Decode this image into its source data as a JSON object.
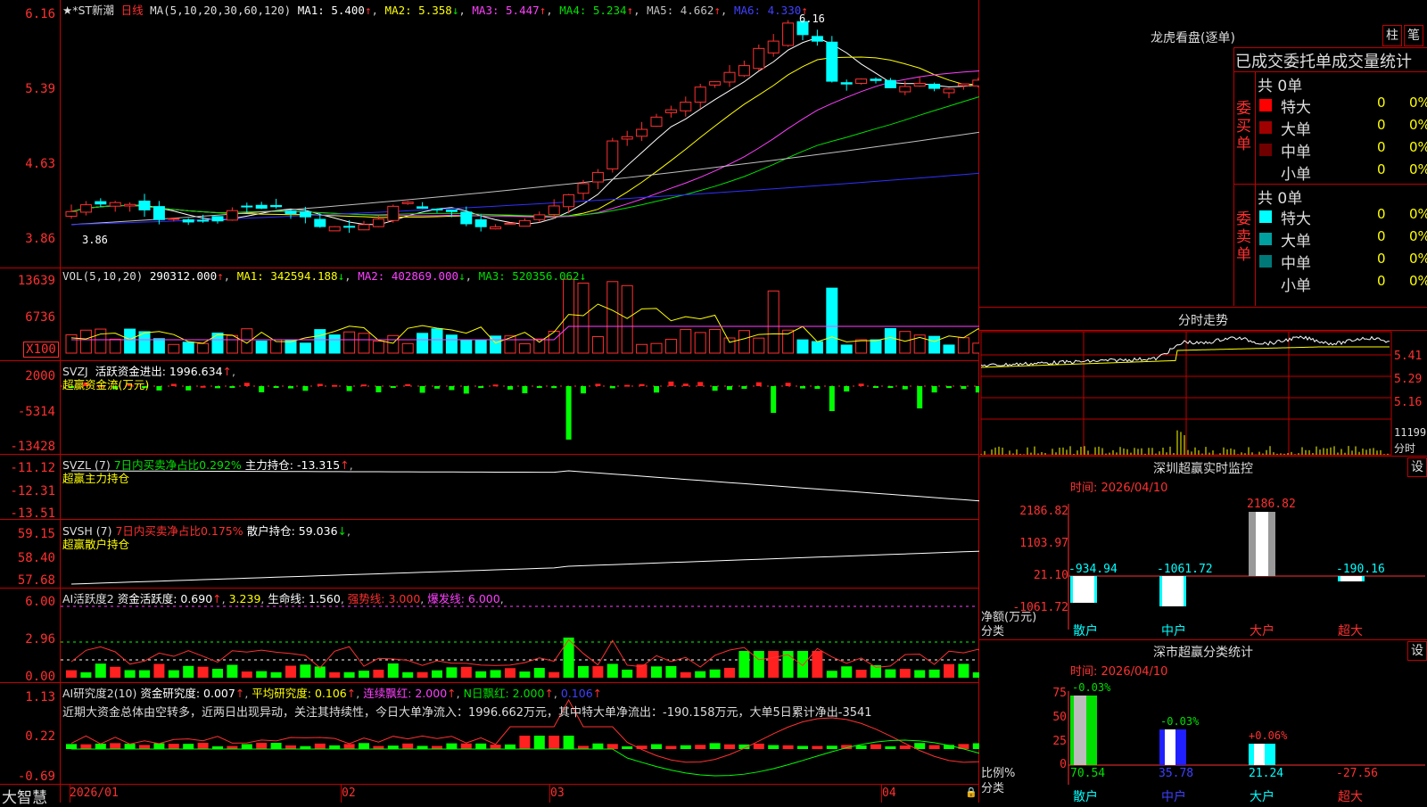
{
  "app_logo": "大智慧",
  "colors": {
    "red": "#ff3030",
    "cyan": "#00ffff",
    "green": "#00e000",
    "yellow": "#ffff00",
    "magenta": "#ff40ff",
    "white": "#ffffff",
    "blue": "#4040ff",
    "grid": "#c00000"
  },
  "chart": {
    "stock_name": "★*ST新潮",
    "period": "日线",
    "ma_label": "MA(5,10,20,30,60,120)",
    "ma1": "MA1: 5.400",
    "ma2": "MA2: 5.358",
    "ma3": "MA3: 5.447",
    "ma4": "MA4: 5.234",
    "ma5": "MA5: 4.662",
    "ma6": "MA6: 4.330",
    "high_label": "6.16",
    "low_label": "3.86",
    "price_axis": [
      "6.16",
      "5.39",
      "4.63",
      "3.86"
    ],
    "vol_label": "VOL(5,10,20)",
    "vol_value": "290312.000",
    "vol_ma1": "MA1: 342594.188",
    "vol_ma2": "MA2: 402869.000",
    "vol_ma3": "MA3: 520356.062",
    "vol_axis": [
      "13639",
      "6736",
      "X100"
    ],
    "svzj_label": "SVZJ",
    "svzj_text": "活跃资金进出: 1996.634",
    "svzj_sub": "超赢资金流(万元)",
    "svzj_axis": [
      "2000",
      "-5314",
      "-13428"
    ],
    "svzl_label": "SVZL (7)",
    "svzl_text1": "7日内买卖净占比0.292%",
    "svzl_text2": "主力持仓: -13.315",
    "svzl_sub": "超赢主力持仓",
    "svzl_axis": [
      "-11.12",
      "-12.31",
      "-13.51"
    ],
    "svsh_label": "SVSH (7)",
    "svsh_text1": "7日内买卖净占比0.175%",
    "svsh_text2": "散户持仓: 59.036",
    "svsh_sub": "超赢散户持仓",
    "svsh_axis": [
      "59.15",
      "58.40",
      "57.68"
    ],
    "ai2_label": "AI活跃度2",
    "ai2_text1": "资金活跃度: 0.690",
    "ai2_text2": "3.239",
    "ai2_text3": "生命线: 1.560",
    "ai2_text4": "强势线: 3.000",
    "ai2_text5": "爆发线: 6.000",
    "ai2_axis": [
      "6.00",
      "2.96",
      "0.00"
    ],
    "ai_res_label": "AI研究度2(10)",
    "ai_res_text1": "资金研究度: 0.007",
    "ai_res_text2": "平均研究度: 0.106",
    "ai_res_text3": "连续飘红: 2.000",
    "ai_res_text4": "N日飘红: 2.000",
    "ai_res_text5": "0.106",
    "ai_res_comment": "近期大资金总体由空转多，近两日出现异动，关注其持续性，今日大单净流入：1996.662万元，其中特大单净流出：-190.158万元，大单5日累计净出-3541",
    "ai_res_axis": [
      "1.13",
      "0.22",
      "-0.69"
    ],
    "dates": [
      "2026/01",
      "02",
      "03",
      "04"
    ]
  },
  "right": {
    "lhb_title": "龙虎看盘(逐单)",
    "btn_zhu": "柱",
    "btn_bi": "笔",
    "stats_title": "已成交委托单成交量统计",
    "buy_count": "共 0单",
    "buy_side": [
      "委",
      "买",
      "单"
    ],
    "buy_rows": [
      {
        "label": "特大",
        "value": "0",
        "pct": "0%",
        "color": "#ff0000"
      },
      {
        "label": "大单",
        "value": "0",
        "pct": "0%",
        "color": "#a00000"
      },
      {
        "label": "中单",
        "value": "0",
        "pct": "0%",
        "color": "#700000"
      },
      {
        "label": "小单",
        "value": "0",
        "pct": "0%",
        "color": ""
      }
    ],
    "sell_count": "共 0单",
    "sell_side": [
      "委",
      "卖",
      "单"
    ],
    "sell_rows": [
      {
        "label": "特大",
        "value": "0",
        "pct": "0%",
        "color": "#00ffff"
      },
      {
        "label": "大单",
        "value": "0",
        "pct": "0%",
        "color": "#00a0a0"
      },
      {
        "label": "中单",
        "value": "0",
        "pct": "0%",
        "color": "#007878"
      },
      {
        "label": "小单",
        "value": "0",
        "pct": "0%",
        "color": ""
      }
    ],
    "intraday_title": "分时走势",
    "intraday_axis": [
      "5.41",
      "5.29",
      "5.16",
      "11199",
      "分时"
    ],
    "monitor_title": "深圳超赢实时监控",
    "monitor_btn": "设",
    "monitor_time": "时间: 2026/04/10",
    "monitor_axis": [
      "2186.82",
      "1103.97",
      "21.10",
      "-1061.72"
    ],
    "monitor_bottom_labels": [
      "净额(万元)",
      "分类"
    ],
    "monitor_cats": [
      "散户",
      "中户",
      "大户",
      "超大"
    ],
    "monitor_values": [
      "-934.94",
      "-1061.72",
      "2186.82",
      "-190.16"
    ],
    "class_title": "深市超赢分类统计",
    "class_btn": "设",
    "class_time": "时间: 2026/04/10",
    "class_axis": [
      "75",
      "50",
      "25",
      "0"
    ],
    "class_bottom_labels": [
      "比例%",
      "分类"
    ],
    "class_cats": [
      "散户",
      "中户",
      "大户",
      "超大"
    ],
    "class_values": [
      "70.54",
      "35.78",
      "21.24",
      "-27.56"
    ],
    "class_changes": [
      "-0.03%",
      "-0.03%",
      "+0.06%",
      ""
    ]
  }
}
